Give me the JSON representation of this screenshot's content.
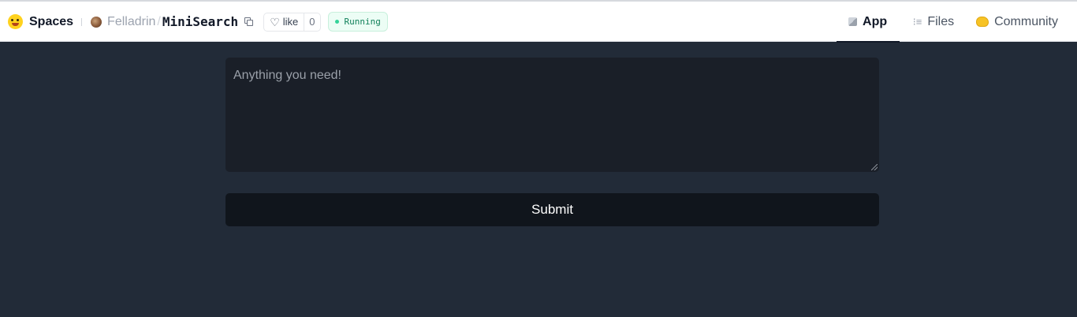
{
  "header": {
    "brand_label": "Spaces",
    "owner": "Felladrin",
    "separator": "/",
    "repo": "MiniSearch",
    "like_label": "like",
    "like_count": "0",
    "status": "Running"
  },
  "tabs": [
    {
      "label": "App",
      "icon": "cube-icon",
      "active": true
    },
    {
      "label": "Files",
      "icon": "files-icon",
      "active": false
    },
    {
      "label": "Community",
      "icon": "community-icon",
      "active": false
    }
  ],
  "main": {
    "query_placeholder": "Anything you need!",
    "submit_label": "Submit"
  },
  "colors": {
    "page_background": "#222b38",
    "input_background": "#1a1f28",
    "button_background": "#10151c",
    "status_green": "#34d399"
  }
}
